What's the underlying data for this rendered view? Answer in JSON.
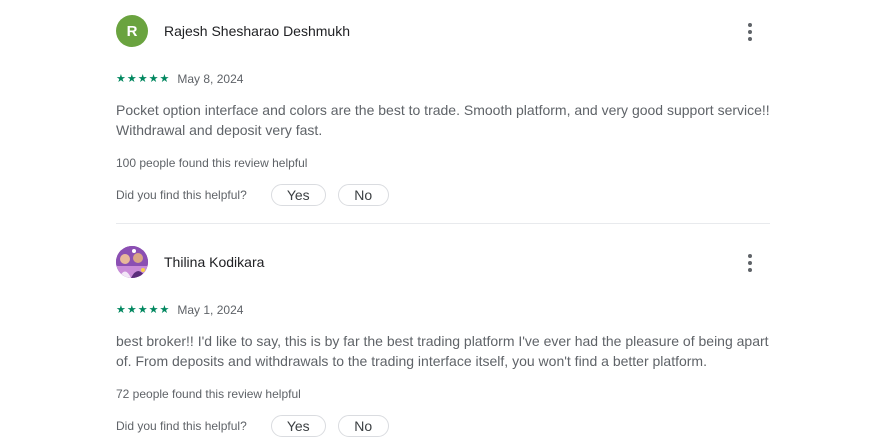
{
  "reviews": [
    {
      "avatar_letter": "R",
      "name": "Rajesh Shesharao Deshmukh",
      "rating": 5,
      "date": "May 8, 2024",
      "text": "Pocket option interface and colors are the best to trade. Smooth platform, and very good support service!! Withdrawal and deposit very fast.",
      "helpful_count": "100 people found this review helpful",
      "helpful_prompt": "Did you find this helpful?",
      "yes_label": "Yes",
      "no_label": "No"
    },
    {
      "avatar_letter": "",
      "name": "Thilina Kodikara",
      "rating": 5,
      "date": "May 1, 2024",
      "text": "best broker!! I'd like to say, this is by far the best trading platform I've ever had the pleasure of being apart of. From deposits and withdrawals to the trading interface itself, you won't find a better platform.",
      "helpful_count": "72 people found this review helpful",
      "helpful_prompt": "Did you find this helpful?",
      "yes_label": "Yes",
      "no_label": "No"
    }
  ],
  "icons": {
    "star": "star-icon",
    "more": "more-vert-icon"
  },
  "colors": {
    "star": "#01875f",
    "avatar_letter_bg": "#6aa33f"
  }
}
